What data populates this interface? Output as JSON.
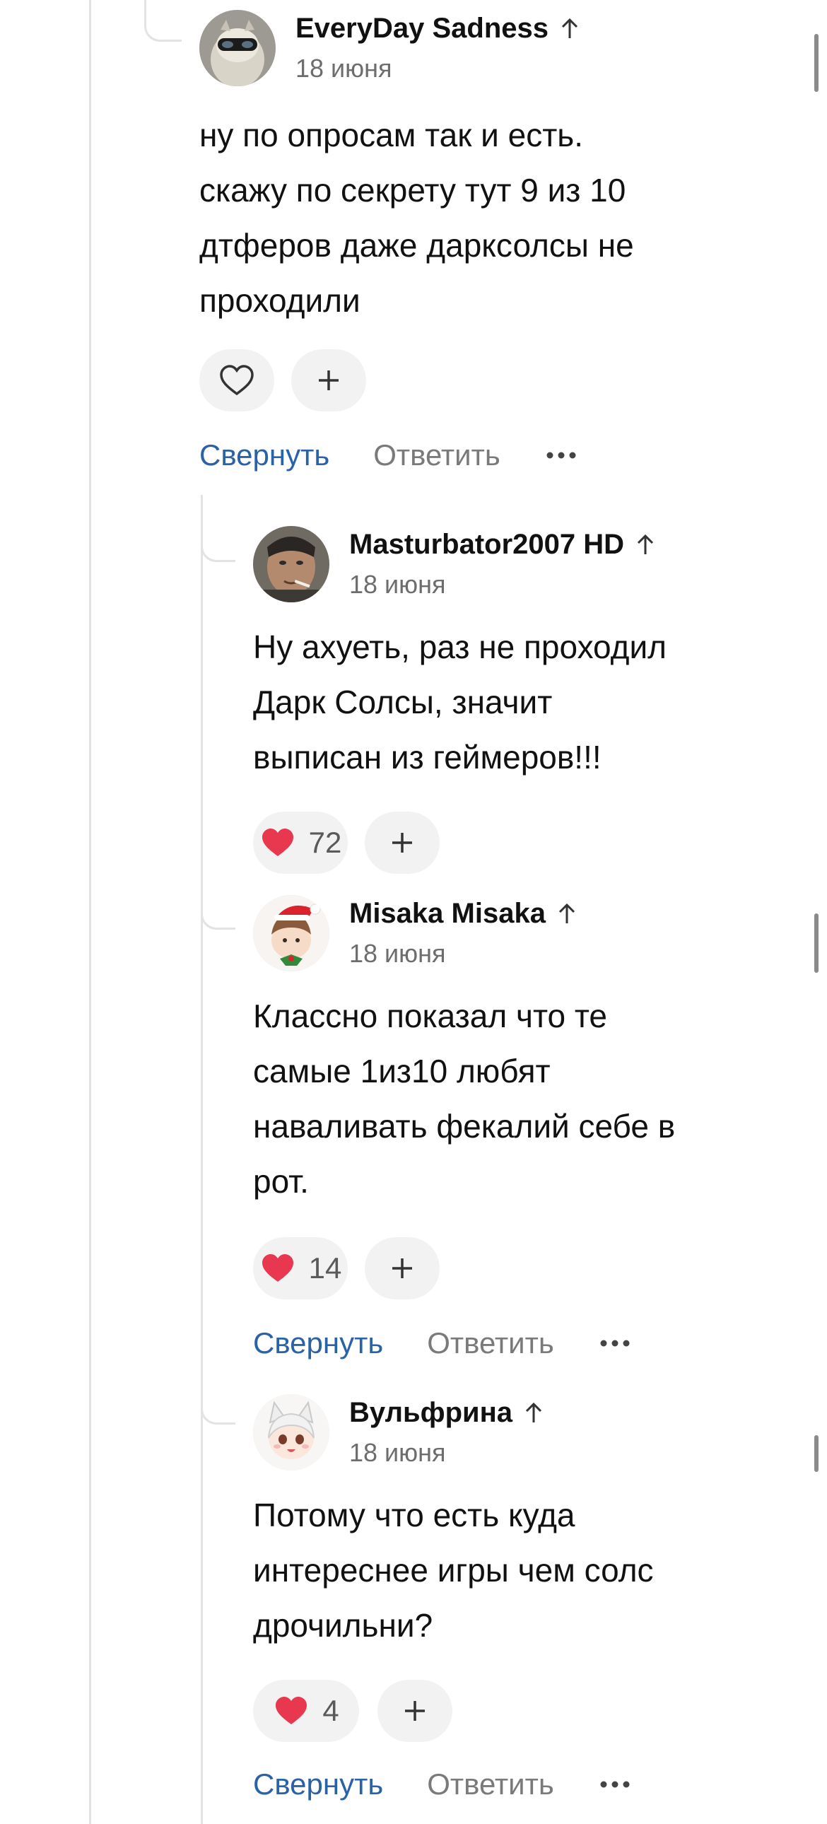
{
  "comments": [
    {
      "author": "EveryDay Sadness",
      "date": "18 июня",
      "text": "ну по опросам так и есть.\nскажу по секрету тут 9 из 10\nдтферов даже дарксолсы не\nпроходили",
      "likes": null,
      "liked": false,
      "avatar_icon": "masked-cat-avatar",
      "collapse_label": "Свернуть",
      "reply_label": "Ответить"
    },
    {
      "author": "Masturbator2007 HD",
      "date": "18 июня",
      "text": "Ну ахуеть, раз не проходил\nДарк Солсы, значит\nвыписан из геймеров!!!",
      "likes": "72",
      "liked": true,
      "avatar_icon": "man-smoking-avatar"
    },
    {
      "author": "Misaka Misaka",
      "date": "18 июня",
      "text": "Классно показал что те\nсамые 1из10 любят\nнаваливать фекалий себе в\nрот.",
      "likes": "14",
      "liked": true,
      "avatar_icon": "anime-santa-avatar",
      "collapse_label": "Свернуть",
      "reply_label": "Ответить"
    },
    {
      "author": "Вульфрина",
      "date": "18 июня",
      "text": "Потому что есть куда\nинтереснее игры чем солс\nдрочильни?",
      "likes": "4",
      "liked": true,
      "avatar_icon": "anime-wolf-girl-avatar",
      "collapse_label": "Свернуть",
      "reply_label": "Ответить"
    }
  ],
  "colors": {
    "accent_link": "#2a62a8",
    "like_red": "#e8384f",
    "muted": "#7a7a7a",
    "pill_bg": "#f2f2f2"
  }
}
